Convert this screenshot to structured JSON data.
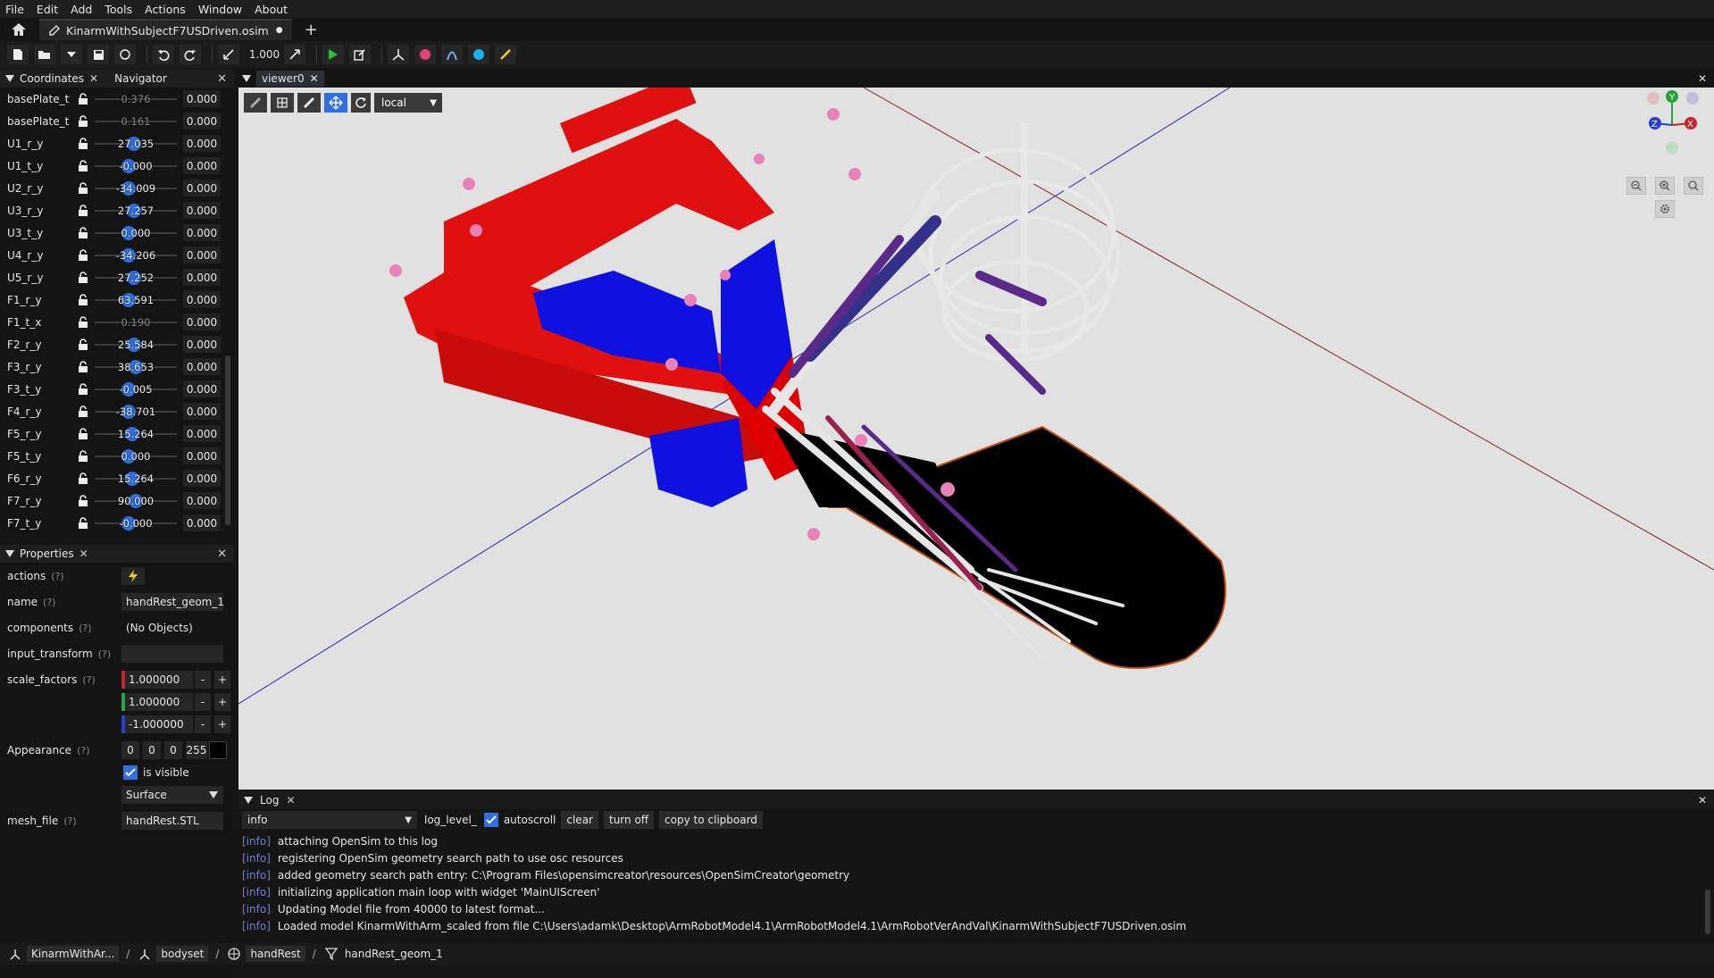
{
  "menu": [
    "File",
    "Edit",
    "Add",
    "Tools",
    "Actions",
    "Window",
    "About"
  ],
  "tab": {
    "title": "KinarmWithSubjectF7USDriven.osim",
    "modified": "●"
  },
  "toolbar": {
    "scale": "1.000"
  },
  "coordinates_panel": {
    "title": "Coordinates",
    "other_tab": "Navigator"
  },
  "coordinates": [
    {
      "name": "basePlate_t",
      "slider": "0.376",
      "pos": 0.5,
      "value": "0.000",
      "dim": true
    },
    {
      "name": "basePlate_t",
      "slider": "0.161",
      "pos": 0.5,
      "value": "0.000",
      "dim": true
    },
    {
      "name": "U1_r_y",
      "slider": "27.035",
      "pos": 0.48,
      "value": "0.000"
    },
    {
      "name": "U1_t_y",
      "slider": "-0.000",
      "pos": 0.4,
      "value": "0.000"
    },
    {
      "name": "U2_r_y",
      "slider": "-34.009",
      "pos": 0.4,
      "value": "0.000"
    },
    {
      "name": "U3_r_y",
      "slider": "27.257",
      "pos": 0.48,
      "value": "0.000"
    },
    {
      "name": "U3_t_y",
      "slider": "0.000",
      "pos": 0.4,
      "value": "0.000"
    },
    {
      "name": "U4_r_y",
      "slider": "-34.206",
      "pos": 0.4,
      "value": "0.000"
    },
    {
      "name": "U5_r_y",
      "slider": "27.252",
      "pos": 0.48,
      "value": "0.000"
    },
    {
      "name": "F1_r_y",
      "slider": "63.591",
      "pos": 0.4,
      "value": "0.000"
    },
    {
      "name": "F1_t_x",
      "slider": "0.190",
      "pos": 0.5,
      "value": "0.000",
      "dim": true
    },
    {
      "name": "F2_r_y",
      "slider": "25.584",
      "pos": 0.48,
      "value": "0.000"
    },
    {
      "name": "F3_r_y",
      "slider": "38.653",
      "pos": 0.5,
      "value": "0.000"
    },
    {
      "name": "F3_t_y",
      "slider": "-0.005",
      "pos": 0.4,
      "value": "0.000"
    },
    {
      "name": "F4_r_y",
      "slider": "-38.701",
      "pos": 0.4,
      "value": "0.000"
    },
    {
      "name": "F5_r_y",
      "slider": "15.264",
      "pos": 0.45,
      "value": "0.000"
    },
    {
      "name": "F5_t_y",
      "slider": "0.000",
      "pos": 0.4,
      "value": "0.000"
    },
    {
      "name": "F6_r_y",
      "slider": "15.264",
      "pos": 0.45,
      "value": "0.000"
    },
    {
      "name": "F7_r_y",
      "slider": "90.000",
      "pos": 0.5,
      "value": "0.000"
    },
    {
      "name": "F7_t_y",
      "slider": "-0.000",
      "pos": 0.4,
      "value": "0.000"
    }
  ],
  "properties_panel": {
    "title": "Properties"
  },
  "properties": {
    "actions_label": "actions",
    "q": "(?)",
    "name_label": "name",
    "name_value": "handRest_geom_1",
    "components_label": "components",
    "components_value": "(No Objects)",
    "input_transform_label": "input_transform",
    "input_transform_value": "",
    "scale_factors_label": "scale_factors",
    "scale_factors": [
      "1.000000",
      "1.000000",
      "-1.000000"
    ],
    "scale_colors": [
      "#c0282d",
      "#27a34a",
      "#2a3fd0"
    ],
    "appearance_label": "Appearance",
    "appearance_rgba": [
      "0",
      "0",
      "0",
      "255"
    ],
    "is_visible_label": "is visible",
    "representation": "Surface",
    "mesh_file_label": "mesh_file",
    "mesh_file_value": "handRest.STL"
  },
  "viewer": {
    "tab": "viewer0",
    "frame": "local"
  },
  "log_panel": {
    "title": "Log",
    "level": "info",
    "level_label": "log_level_",
    "autoscroll": "autoscroll",
    "clear": "clear",
    "turn_off": "turn off",
    "copy": "copy to clipboard"
  },
  "log": [
    {
      "level": "[info]",
      "msg": "attaching OpenSim to this log"
    },
    {
      "level": "[info]",
      "msg": "registering OpenSim geometry search path to use osc resources"
    },
    {
      "level": "[info]",
      "msg": "added geometry search path entry: C:\\Program Files\\opensimcreator\\resources\\OpenSimCreator\\geometry"
    },
    {
      "level": "[info]",
      "msg": "initializing application main loop with widget 'MainUIScreen'"
    },
    {
      "level": "[info]",
      "msg": "Updating Model file from 40000 to latest format..."
    },
    {
      "level": "[info]",
      "msg": "Loaded model KinarmWithArm_scaled from file C:\\Users\\adamk\\Desktop\\ArmRobotModel4.1\\ArmRobotModel4.1\\ArmRobotVerAndVal\\KinarmWithSubjectF7USDriven.osim"
    }
  ],
  "statusbar": {
    "model": "KinarmWithAr...",
    "sep": "/",
    "bodyset": "bodyset",
    "body": "handRest",
    "geom": "handRest_geom_1"
  },
  "colors": {
    "accent": "#2f6fe0",
    "robot_red": "#e01010",
    "robot_blue": "#1010e0",
    "bone": "#e8e8e8",
    "muscle": "#5a2a8a",
    "marker": "#e882b8"
  },
  "icons": [
    "home-icon",
    "file-icon",
    "folder-open-icon",
    "save-icon",
    "reload-icon",
    "undo-icon",
    "redo-icon",
    "expand-icon",
    "play-icon",
    "edit-icon",
    "axes-icon",
    "record-icon",
    "arc-icon",
    "sphere-icon",
    "wand-icon",
    "lock-icon",
    "lightning-icon",
    "check-icon",
    "zoom-out-icon",
    "zoom-in-icon",
    "zoom-fit-icon",
    "gear-icon",
    "move-icon",
    "rotate-icon"
  ]
}
